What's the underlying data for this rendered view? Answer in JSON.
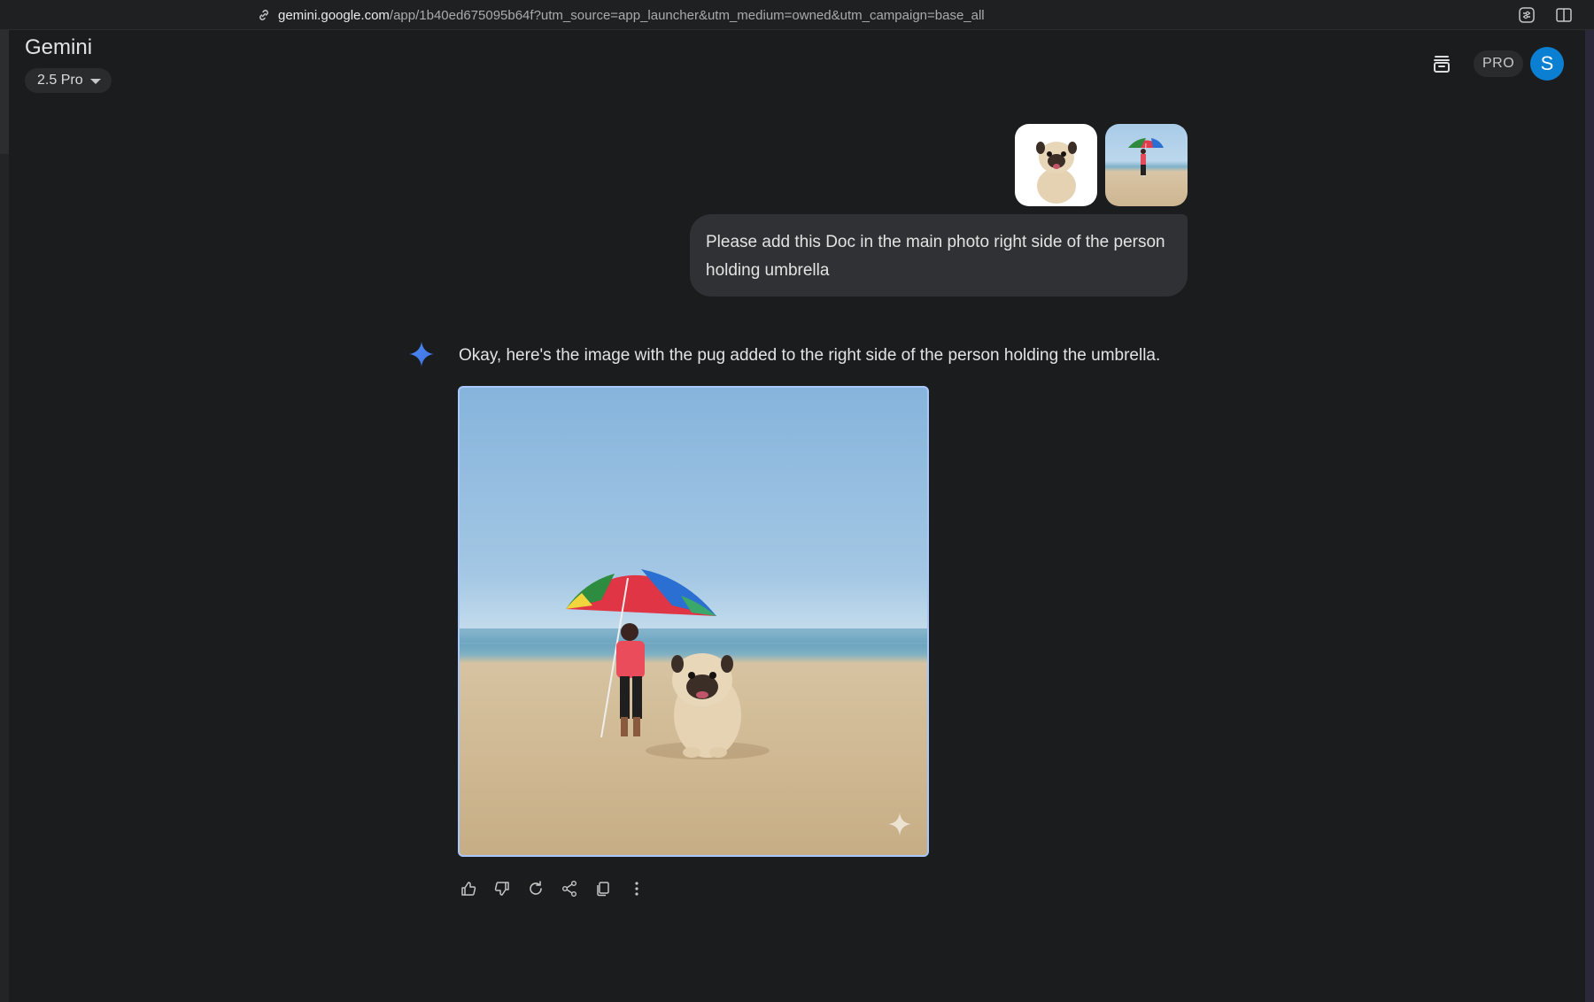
{
  "browser": {
    "url_host": "gemini.google.com",
    "url_path": "/app/1b40ed675095b64f?utm_source=app_launcher&utm_medium=owned&utm_campaign=base_all"
  },
  "header": {
    "brand": "Gemini",
    "model": "2.5 Pro",
    "pro_badge": "PRO",
    "avatar_letter": "S"
  },
  "colors": {
    "background": "#1b1c1d",
    "bubble": "#303134",
    "accent_blue": "#4c8df6",
    "avatar": "#0b7fd1",
    "image_border": "#a8c7fa"
  },
  "conversation": {
    "user_message": "Please add this Doc in the main photo right side of the person holding umbrella",
    "response_text": "Okay, here's the image with the pug added to the right side of the person holding the umbrella."
  },
  "icons": {
    "link": "link-icon",
    "tune": "tune-icon",
    "side_panel": "side-panel-icon",
    "chat_history": "chat-history-icon",
    "gemini_spark": "gemini-spark-icon",
    "like": "thumbs-up-icon",
    "dislike": "thumbs-down-icon",
    "redo": "redo-icon",
    "share": "share-icon",
    "copy": "copy-icon",
    "more": "more-vert-icon"
  }
}
